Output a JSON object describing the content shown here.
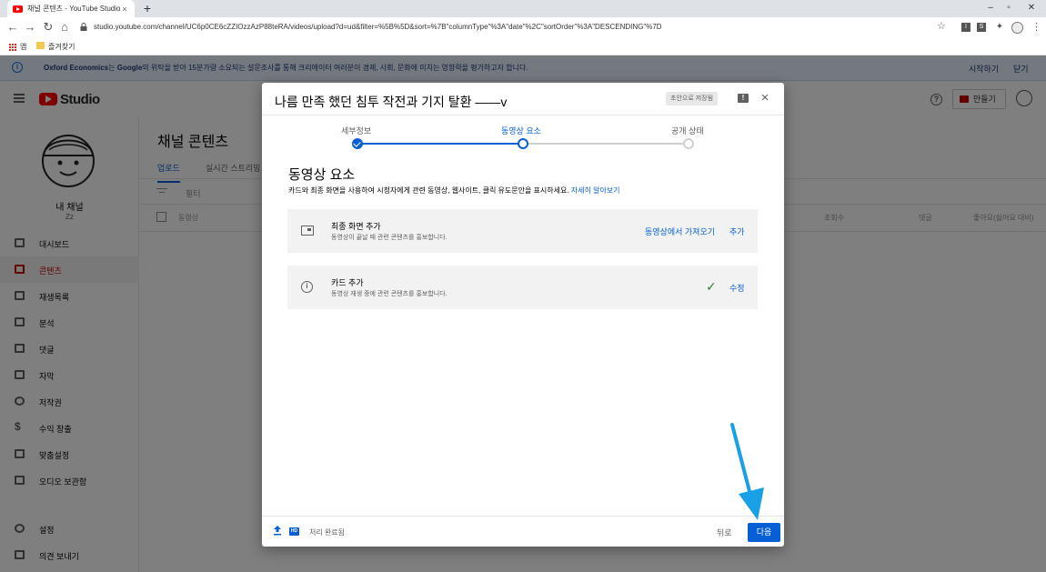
{
  "browser": {
    "tab_title": "채널 콘텐츠 - YouTube Studio",
    "tab_close": "×",
    "new_tab": "+",
    "url": "studio.youtube.com/channel/UC6p0CE6cZZIOzzAzP88teRA/videos/upload?d=ud&filter=%5B%5D&sort=%7B\"columnType\"%3A\"date\"%2C\"sortOrder\"%3A\"DESCENDING\"%7D",
    "bookmarks": [
      "앱",
      "즐겨찾기"
    ],
    "extensions": [
      "I",
      "S"
    ]
  },
  "banner": {
    "brand": "Oxford Economics",
    "text_mid": "는 ",
    "brand2": "Google",
    "text_rest": "의 위탁을 받아 15분가량 소요되는 설문조사를 통해 크리에이터 여러분이 경제, 사회, 문화에 미치는 영향력을 평가하고자 합니다.",
    "start": "시작하기",
    "close": "닫기"
  },
  "header": {
    "logo_text": "Studio",
    "create_label": "만들기"
  },
  "sidebar": {
    "channel_name": "내 채널",
    "channel_sub": "Zz",
    "items": [
      {
        "label": "대시보드",
        "icon": "dashboard-icon"
      },
      {
        "label": "콘텐츠",
        "icon": "content-icon"
      },
      {
        "label": "재생목록",
        "icon": "playlist-icon"
      },
      {
        "label": "분석",
        "icon": "analytics-icon"
      },
      {
        "label": "댓글",
        "icon": "comments-icon"
      },
      {
        "label": "자막",
        "icon": "subtitles-icon"
      },
      {
        "label": "저작권",
        "icon": "copyright-icon"
      },
      {
        "label": "수익 창출",
        "icon": "monetization-icon"
      },
      {
        "label": "맞춤설정",
        "icon": "customization-icon"
      },
      {
        "label": "오디오 보관함",
        "icon": "audio-library-icon"
      }
    ],
    "bottom_items": [
      {
        "label": "설정",
        "icon": "settings-icon"
      },
      {
        "label": "의견 보내기",
        "icon": "feedback-icon"
      }
    ]
  },
  "content": {
    "title": "채널 콘텐츠",
    "tabs": [
      "업로드",
      "실시간 스트리밍"
    ],
    "filter": "필터",
    "columns": [
      "동영상",
      "조회수",
      "댓글",
      "좋아요(싫어요 대비)"
    ]
  },
  "dialog": {
    "title": "나름 만족 했던 침투 작전과 기지 탈환 ——v",
    "draft_status": "초안으로 저장됨",
    "close": "×",
    "steps": [
      {
        "label": "세부정보",
        "state": "done"
      },
      {
        "label": "동영상 요소",
        "state": "current"
      },
      {
        "label": "공개 상태",
        "state": "todo"
      }
    ],
    "section_title": "동영상 요소",
    "section_desc": "카드와 최종 화면을 사용하여 시청자에게 관련 동영상, 웹사이트, 클릭 유도문안을 표시하세요. ",
    "learn_more": "자세히 알아보기",
    "cards": [
      {
        "title": "최종 화면 추가",
        "sub": "동영상이 끝날 때 관련 콘텐츠를 홍보합니다.",
        "import_label": "동영상에서 가져오기",
        "action_label": "추가"
      },
      {
        "title": "카드 추가",
        "sub": "동영상 재생 중에 관련 콘텐츠를 홍보합니다.",
        "check": "✓",
        "action_label": "수정"
      }
    ],
    "footer": {
      "hd": "HD",
      "processing": "처리 완료됨",
      "back": "뒤로",
      "next": "다음"
    }
  },
  "colors": {
    "accent": "#065fd4",
    "brand_red": "#cc0000",
    "annotation_arrow": "#1aa0e6"
  }
}
